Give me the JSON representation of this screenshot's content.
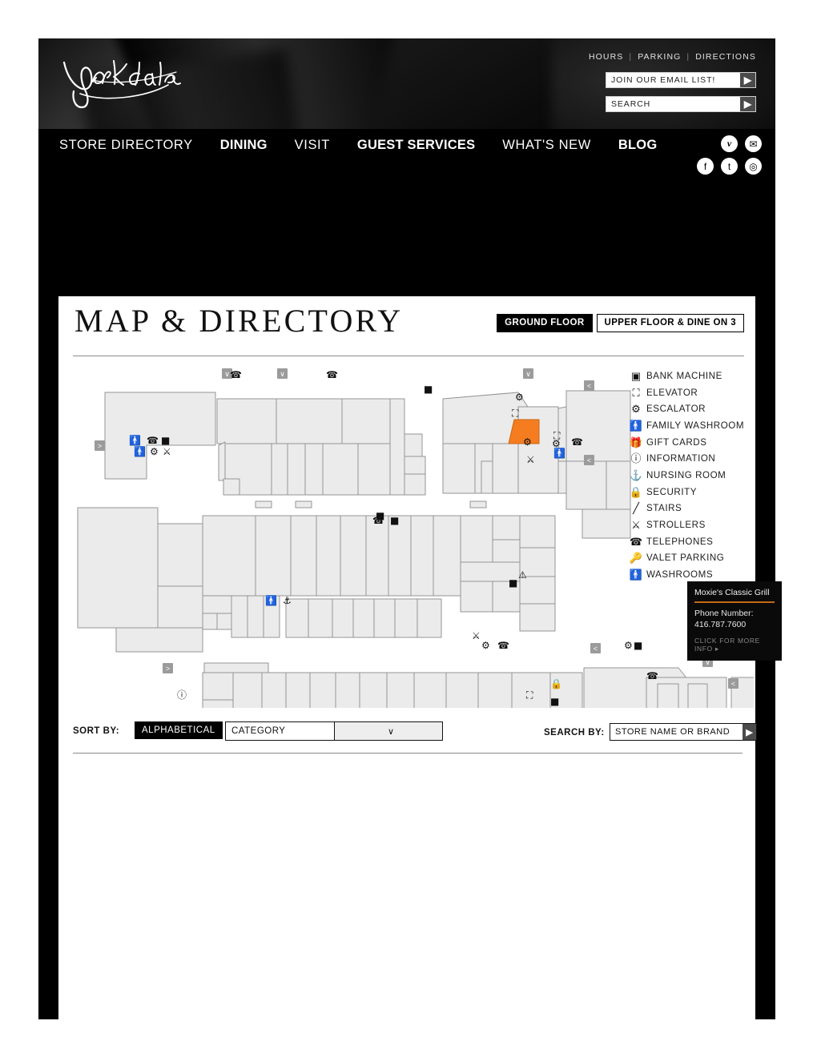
{
  "header": {
    "logo_text": "Yorkdale",
    "top_links": [
      "HOURS",
      "PARKING",
      "DIRECTIONS"
    ],
    "email_input": {
      "value": "JOIN OUR EMAIL LIST!",
      "placeholder": "JOIN OUR EMAIL LIST!",
      "go": "▶"
    },
    "search_input": {
      "value": "SEARCH",
      "placeholder": "SEARCH",
      "go": "▶"
    }
  },
  "nav": {
    "items": [
      {
        "label": "STORE DIRECTORY",
        "bold": false
      },
      {
        "label": "DINING",
        "bold": true
      },
      {
        "label": "VISIT",
        "bold": false
      },
      {
        "label": "GUEST SERVICES",
        "bold": true
      },
      {
        "label": "WHAT'S NEW",
        "bold": false
      },
      {
        "label": "BLOG",
        "bold": true
      }
    ],
    "social": [
      {
        "name": "vimeo-icon",
        "glyph": "v"
      },
      {
        "name": "email-icon",
        "glyph": "✉"
      }
    ],
    "social_row2": [
      {
        "name": "facebook-icon",
        "glyph": "f"
      },
      {
        "name": "twitter-icon",
        "glyph": "t"
      },
      {
        "name": "instagram-icon",
        "glyph": "◎"
      }
    ]
  },
  "page_title": "MAP & DIRECTORY",
  "floor_buttons": [
    {
      "label": "GROUND FLOOR",
      "active": true
    },
    {
      "label": "UPPER FLOOR & DINE ON 3",
      "active": false
    }
  ],
  "map": {
    "zoom_out": "–",
    "zoom_in": "+",
    "highlight_color": "#f57d20",
    "store_fill": "#ebebeb",
    "store_stroke": "#949494"
  },
  "legend": [
    {
      "label": "BANK MACHINE",
      "icon": "bank-machine-icon"
    },
    {
      "label": "ELEVATOR",
      "icon": "elevator-icon"
    },
    {
      "label": "ESCALATOR",
      "icon": "escalator-icon"
    },
    {
      "label": "FAMILY WASHROOM",
      "icon": "family-washroom-icon"
    },
    {
      "label": "GIFT CARDS",
      "icon": "gift-card-icon"
    },
    {
      "label": "INFORMATION",
      "icon": "information-icon"
    },
    {
      "label": "NURSING ROOM",
      "icon": "nursing-room-icon"
    },
    {
      "label": "SECURITY",
      "icon": "security-icon"
    },
    {
      "label": "STAIRS",
      "icon": "stairs-icon"
    },
    {
      "label": "STROLLERS",
      "icon": "stroller-icon"
    },
    {
      "label": "TELEPHONES",
      "icon": "telephone-icon"
    },
    {
      "label": "VALET PARKING",
      "icon": "valet-parking-icon"
    },
    {
      "label": "WASHROOMS",
      "icon": "washroom-icon"
    }
  ],
  "tooltip": {
    "title": "Moxie's Classic Grill",
    "phone_label": "Phone Number:",
    "phone_number": "416.787.7600",
    "more_info": "CLICK FOR MORE INFO ▸",
    "accent_color": "#c46a16"
  },
  "footer_controls": {
    "sort_by_label": "SORT BY:",
    "alphabetical": "ALPHABETICAL",
    "category": "CATEGORY",
    "category_caret": "∨",
    "search_by_label": "SEARCH BY:",
    "search_value": "STORE NAME OR BRAND",
    "search_placeholder": "STORE NAME OR BRAND",
    "search_go": "▶"
  }
}
